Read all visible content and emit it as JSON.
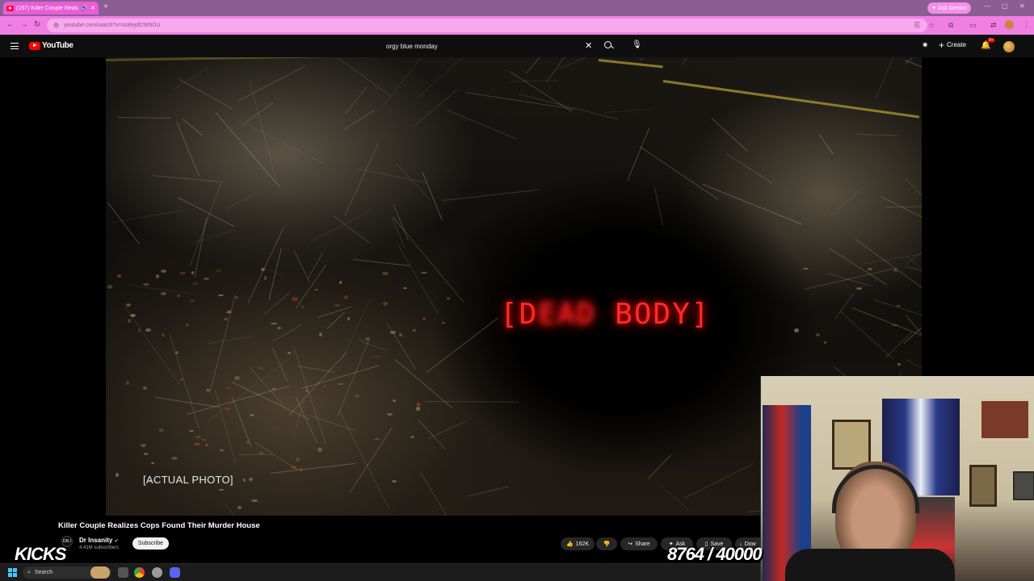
{
  "browser": {
    "tab_title": "(157) Killer Couple Realizes",
    "new_tab_icon": "+",
    "gemini_label": "Ask Gemini",
    "url": "youtube.com/watch?v=oo8ejdt2W9DU"
  },
  "youtube": {
    "logo_text": "YouTube",
    "search_query": "orgy blue monday",
    "create_label": "Create",
    "notif_badge": "9+"
  },
  "video": {
    "overlay_text_start": "[D",
    "overlay_text_blurred": "EAD",
    "overlay_text_end": " BODY]",
    "caption": "[ACTUAL PHOTO]",
    "title": "Killer Couple Realizes Cops Found Their Murder House"
  },
  "channel": {
    "avatar_text": "DR.I",
    "name": "Dr Insanity",
    "verified": "✔",
    "subscribers": "4.41M subscribers",
    "subscribe_label": "Subscribe"
  },
  "actions": {
    "likes": "162K",
    "share": "Share",
    "ask": "Ask",
    "save": "Save",
    "download": "Dow"
  },
  "overlays": {
    "kicks_logo": "KICKS",
    "counter": "8764 / 40000"
  },
  "taskbar": {
    "search_label": "Search"
  },
  "colors": {
    "tab_pink": "#e95ddb",
    "address_bar": "#f07ee3",
    "yt_red": "#ff0000",
    "overlay_red": "#ff2a2a"
  }
}
